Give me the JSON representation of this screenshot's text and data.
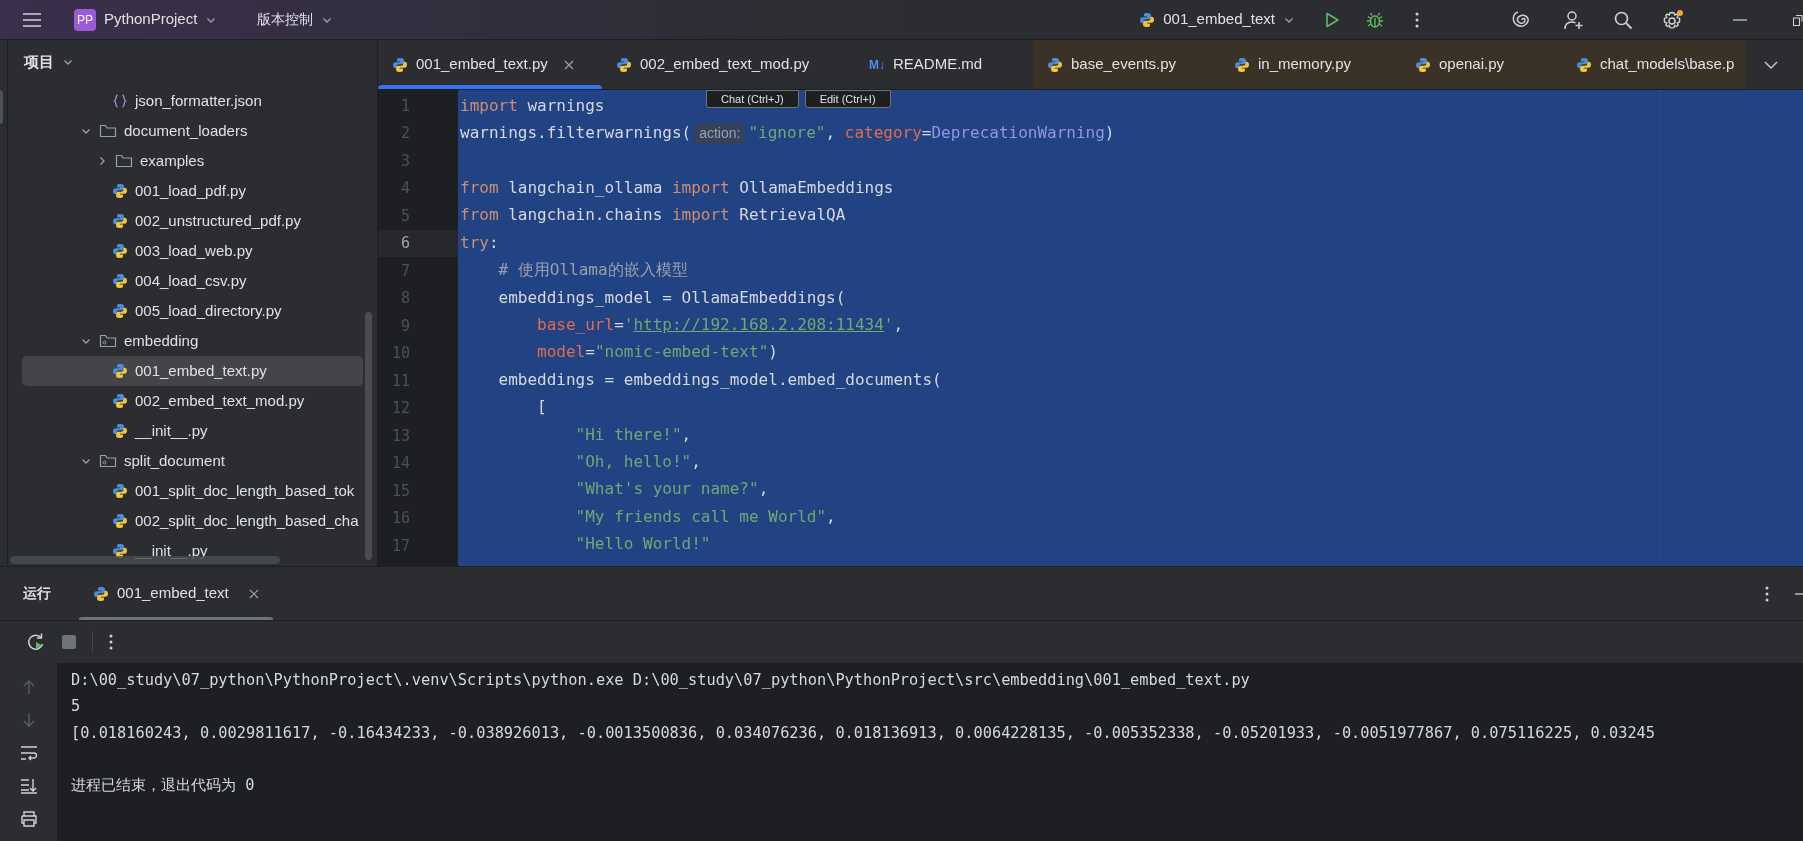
{
  "title_bar": {
    "project_badge": "PP",
    "project": "PythonProject",
    "vcs": "版本控制",
    "run_config": "001_embed_text"
  },
  "project_panel": {
    "title": "项目",
    "tree_continued": [
      {
        "label": "json_formatter.json",
        "kind": "json",
        "selected": false
      }
    ],
    "tree": [
      {
        "label": "document_loaders",
        "kind": "folder",
        "expanded": true,
        "selected": false,
        "children": [
          {
            "label": "examples",
            "kind": "folder",
            "expanded": false,
            "selected": false
          },
          {
            "label": "001_load_pdf.py",
            "kind": "python",
            "selected": false
          },
          {
            "label": "002_unstructured_pdf.py",
            "kind": "python",
            "selected": false
          },
          {
            "label": "003_load_web.py",
            "kind": "python",
            "selected": false
          },
          {
            "label": "004_load_csv.py",
            "kind": "python",
            "selected": false
          },
          {
            "label": "005_load_directory.py",
            "kind": "python",
            "selected": false
          }
        ]
      },
      {
        "label": "embedding",
        "kind": "package",
        "expanded": true,
        "selected": false,
        "children": [
          {
            "label": "001_embed_text.py",
            "kind": "python",
            "selected": true
          },
          {
            "label": "002_embed_text_mod.py",
            "kind": "python",
            "selected": false
          },
          {
            "label": "__init__.py",
            "kind": "python",
            "selected": false
          }
        ]
      },
      {
        "label": "split_document",
        "kind": "package",
        "expanded": true,
        "selected": false,
        "children": [
          {
            "label": "001_split_doc_length_based_tok",
            "kind": "python",
            "selected": false
          },
          {
            "label": "002_split_doc_length_based_cha",
            "kind": "python",
            "selected": false
          },
          {
            "label": "__init__.py",
            "kind": "python",
            "selected": false
          }
        ]
      }
    ]
  },
  "tabs": [
    {
      "label": "001_embed_text.py",
      "kind": "python",
      "selected": true,
      "library": false
    },
    {
      "label": "002_embed_text_mod.py",
      "kind": "python",
      "selected": false,
      "library": false
    },
    {
      "label": "README.md",
      "kind": "markdown",
      "icon_text": "M↓",
      "selected": false,
      "library": false
    },
    {
      "label": "base_events.py",
      "kind": "python",
      "selected": false,
      "library": true
    },
    {
      "label": "in_memory.py",
      "kind": "python",
      "selected": false,
      "library": true
    },
    {
      "label": "openai.py",
      "kind": "python",
      "selected": false,
      "library": true
    },
    {
      "label": "chat_models\\base.p",
      "kind": "python",
      "selected": false,
      "library": true
    }
  ],
  "editor": {
    "all_selected": true,
    "floating_buttons": [
      "Chat (Ctrl+J)",
      "Edit (Ctrl+I)"
    ],
    "lines": [
      {
        "number": "1",
        "current": false,
        "tokens": [
          {
            "text": "import",
            "kind": "keyword"
          },
          {
            "text": " warnings",
            "kind": "plain"
          }
        ]
      },
      {
        "number": "2",
        "current": false,
        "tokens": [
          {
            "text": "warnings.filterwarnings(",
            "kind": "plain"
          },
          {
            "text": "action:",
            "kind": "hint"
          },
          {
            "text": "\"ignore\"",
            "kind": "string"
          },
          {
            "text": ", ",
            "kind": "plain"
          },
          {
            "text": "category",
            "kind": "param"
          },
          {
            "text": "=",
            "kind": "plain"
          },
          {
            "text": "DeprecationWarning",
            "kind": "class"
          },
          {
            "text": ")",
            "kind": "plain"
          }
        ]
      },
      {
        "number": "3",
        "current": false
      },
      {
        "number": "4",
        "current": false,
        "tokens": [
          {
            "text": "from",
            "kind": "keyword"
          },
          {
            "text": " langchain_ollama ",
            "kind": "plain"
          },
          {
            "text": "import",
            "kind": "keyword"
          },
          {
            "text": " OllamaEmbeddings",
            "kind": "plain"
          }
        ]
      },
      {
        "number": "5",
        "current": false,
        "tokens": [
          {
            "text": "from",
            "kind": "keyword"
          },
          {
            "text": " langchain.chains ",
            "kind": "plain"
          },
          {
            "text": "import",
            "kind": "keyword"
          },
          {
            "text": " RetrievalQA",
            "kind": "plain"
          }
        ]
      },
      {
        "number": "6",
        "current": true,
        "tokens": [
          {
            "text": "try",
            "kind": "keyword"
          },
          {
            "text": ":",
            "kind": "plain"
          }
        ]
      },
      {
        "number": "7",
        "current": false,
        "tokens": [
          {
            "text": "    # 使用Ollama的嵌入模型",
            "kind": "comment"
          }
        ]
      },
      {
        "number": "8",
        "current": false,
        "tokens": [
          {
            "text": "    embeddings_model = OllamaEmbeddings(",
            "kind": "plain"
          }
        ]
      },
      {
        "number": "9",
        "current": false,
        "tokens": [
          {
            "text": "        base_url",
            "kind": "param"
          },
          {
            "text": "=",
            "kind": "plain"
          },
          {
            "text": "'",
            "kind": "string"
          },
          {
            "text": "http://192.168.2.208:11434",
            "kind": "link"
          },
          {
            "text": "'",
            "kind": "string"
          },
          {
            "text": ",",
            "kind": "plain"
          }
        ]
      },
      {
        "number": "10",
        "current": false,
        "tokens": [
          {
            "text": "        model",
            "kind": "param"
          },
          {
            "text": "=",
            "kind": "plain"
          },
          {
            "text": "\"nomic-embed-text\"",
            "kind": "string"
          },
          {
            "text": ")",
            "kind": "plain"
          }
        ]
      },
      {
        "number": "11",
        "current": false,
        "tokens": [
          {
            "text": "    embeddings = embeddings_model.embed_documents(",
            "kind": "plain"
          }
        ]
      },
      {
        "number": "12",
        "current": false,
        "tokens": [
          {
            "text": "        [",
            "kind": "plain"
          }
        ]
      },
      {
        "number": "13",
        "current": false,
        "tokens": [
          {
            "text": "            \"Hi there!\"",
            "kind": "string"
          },
          {
            "text": ",",
            "kind": "plain"
          }
        ]
      },
      {
        "number": "14",
        "current": false,
        "tokens": [
          {
            "text": "            \"Oh, hello!\"",
            "kind": "string"
          },
          {
            "text": ",",
            "kind": "plain"
          }
        ]
      },
      {
        "number": "15",
        "current": false,
        "tokens": [
          {
            "text": "            \"What's your name?\"",
            "kind": "string"
          },
          {
            "text": ",",
            "kind": "plain"
          }
        ]
      },
      {
        "number": "16",
        "current": false,
        "tokens": [
          {
            "text": "            \"My friends call me World\"",
            "kind": "string"
          },
          {
            "text": ",",
            "kind": "plain"
          }
        ]
      },
      {
        "number": "17",
        "current": false,
        "tokens": [
          {
            "text": "            \"Hello World!\"",
            "kind": "string"
          }
        ]
      }
    ]
  },
  "run_panel": {
    "title": "运行",
    "tab": {
      "label": "001_embed_text",
      "selected": true
    },
    "console": [
      {
        "kind": "command",
        "text": "D:\\00_study\\07_python\\PythonProject\\.venv\\Scripts\\python.exe D:\\00_study\\07_python\\PythonProject\\src\\embedding\\001_embed_text.py"
      },
      {
        "kind": "output",
        "text": "5"
      },
      {
        "kind": "output",
        "text": "[0.018160243, 0.0029811617, -0.16434233, -0.038926013, -0.0013500836, 0.034076236, 0.018136913, 0.0064228135, -0.005352338, -0.05201933, -0.0051977867, 0.075116225, 0.03245"
      },
      {
        "kind": "blank"
      },
      {
        "kind": "output",
        "text": "进程已结束，退出代码为 0"
      }
    ]
  }
}
